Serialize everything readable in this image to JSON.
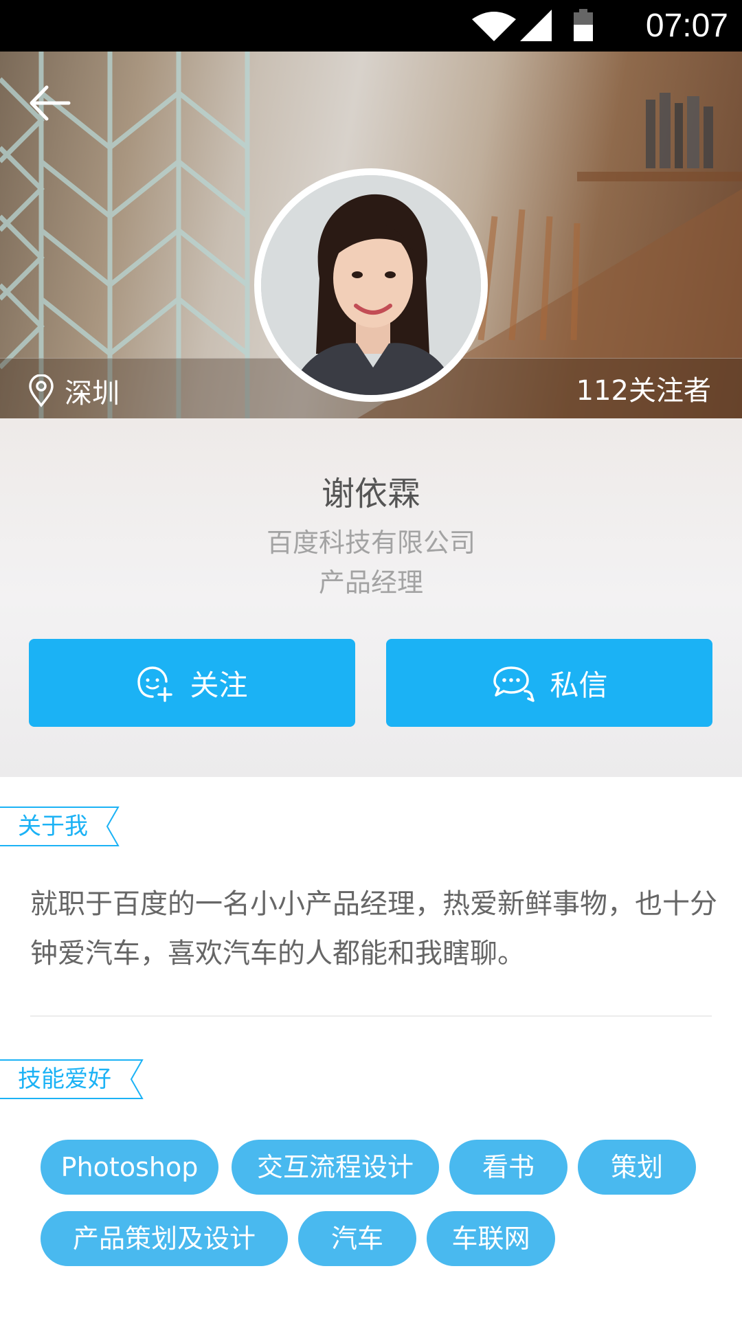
{
  "status_bar": {
    "time": "07:07"
  },
  "profile": {
    "location": "深圳",
    "followers": "112关注者",
    "name": "谢依霖",
    "company": "百度科技有限公司",
    "job_title": "产品经理"
  },
  "actions": {
    "follow_label": "关注",
    "message_label": "私信"
  },
  "about": {
    "heading": "关于我",
    "text": "就职于百度的一名小小产品经理，热爱新鲜事物，也十分钟爱汽车，喜欢汽车的人都能和我瞎聊。"
  },
  "skills": {
    "heading": "技能爱好",
    "items": [
      "Photoshop",
      "交互流程设计",
      "看书",
      "策划",
      "产品策划及设计",
      "汽车",
      "车联网"
    ]
  },
  "colors": {
    "accent": "#1bb2f5",
    "tag": "#49b9ef"
  },
  "icons": [
    "wifi-icon",
    "signal-icon",
    "battery-icon",
    "back-arrow-icon",
    "location-pin-icon",
    "follow-user-icon",
    "chat-bubbles-icon"
  ]
}
